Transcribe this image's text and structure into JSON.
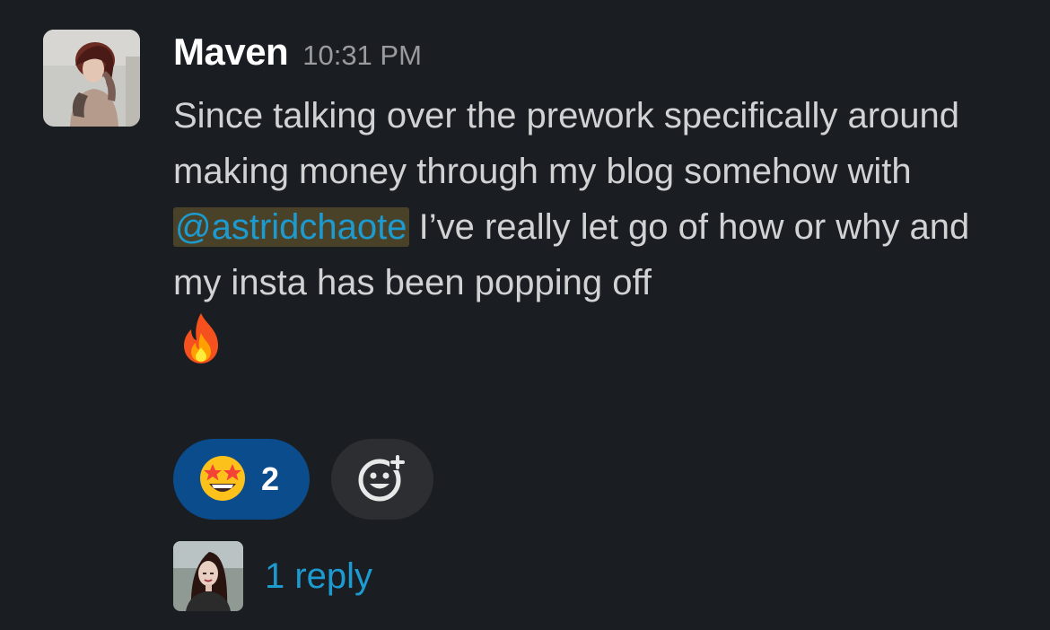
{
  "message": {
    "author": "Maven",
    "timestamp": "10:31 PM",
    "text_before_mention": "Since talking over the prework specifically around making money through my blog somehow with ",
    "mention": "@astridchaote",
    "text_after_mention": " I’ve really let go of how or why and my insta has been popping off",
    "trailing_emoji": "fire-emoji",
    "avatar": "user-photo"
  },
  "reactions": [
    {
      "emoji": "star-struck-emoji",
      "count": "2"
    }
  ],
  "add_reaction": {
    "icon": "add-emoji-icon"
  },
  "thread": {
    "reply_text": "1 reply",
    "avatar": "replier-photo"
  },
  "colors": {
    "background": "#1a1d21",
    "text": "#d1d2d3",
    "link": "#1d9bd1",
    "reaction_bg": "#0b4c8c",
    "add_reaction_bg": "#2c2e32"
  }
}
